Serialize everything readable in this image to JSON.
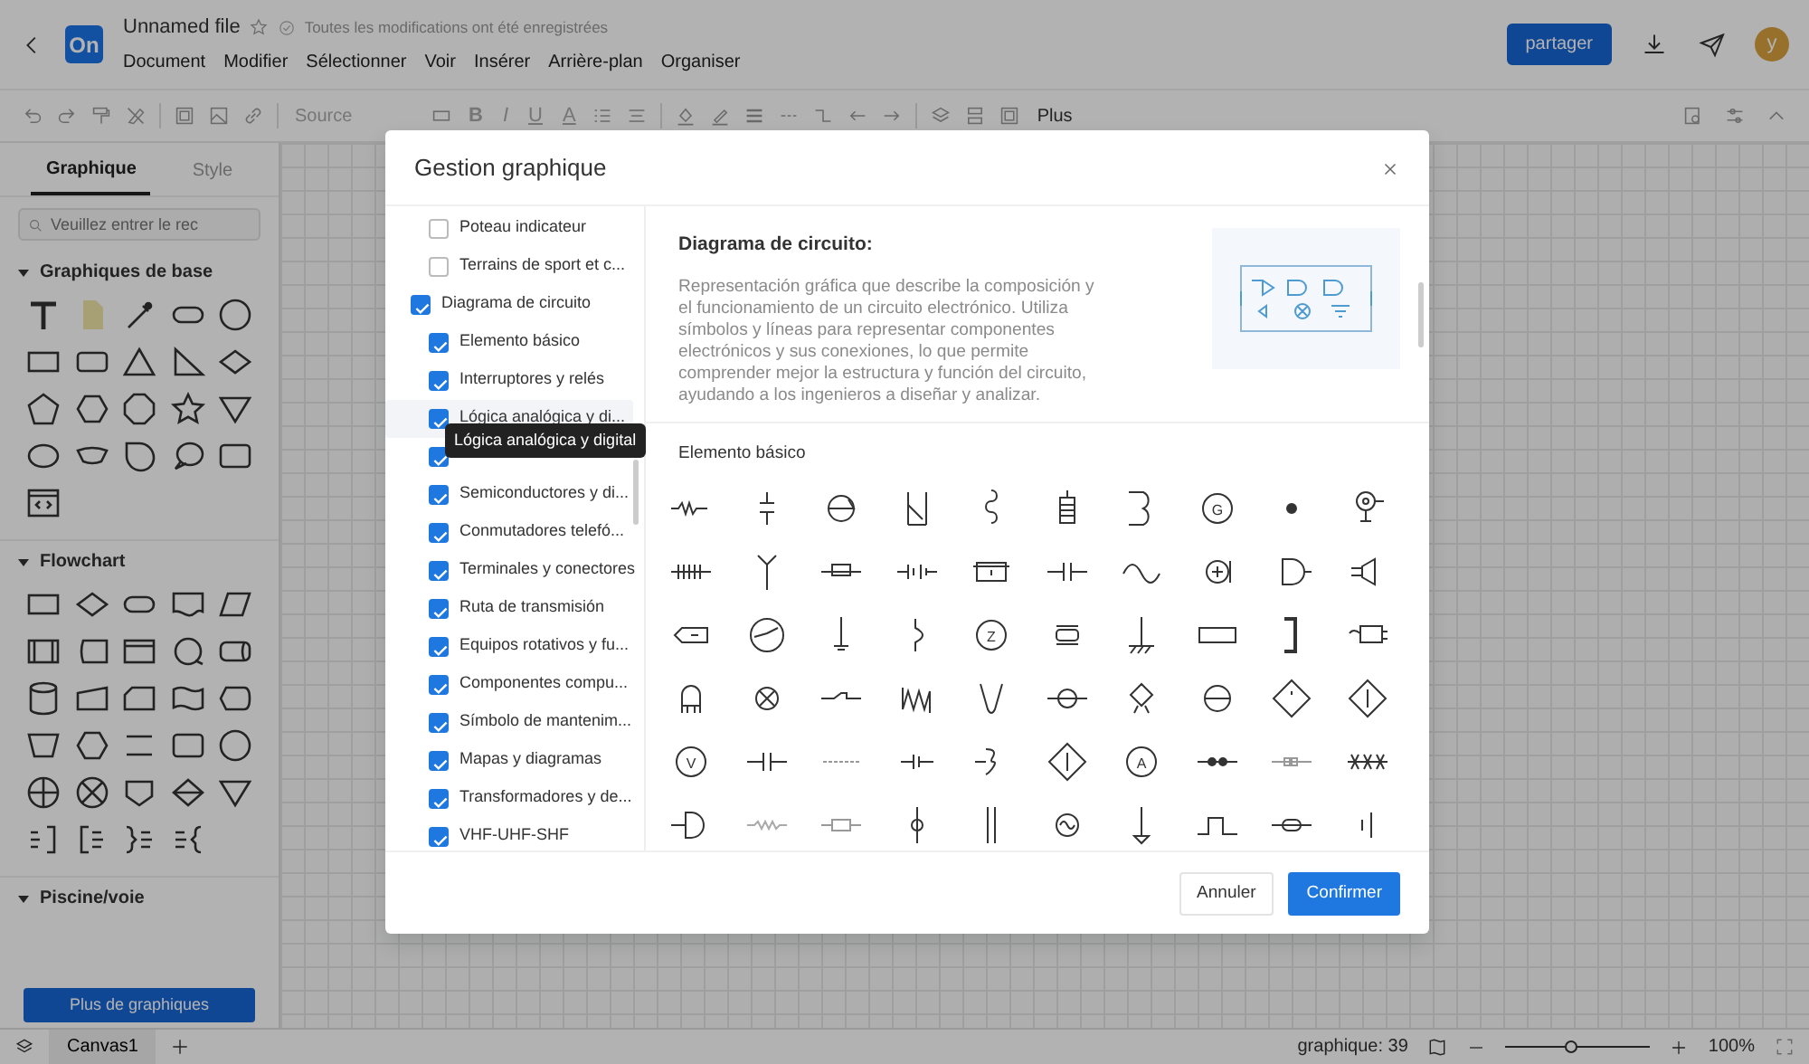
{
  "app": {
    "logo": "On",
    "file_name": "Unnamed file",
    "save_status": "Toutes les modifications ont été enregistrées",
    "menu": [
      "Document",
      "Modifier",
      "Sélectionner",
      "Voir",
      "Insérer",
      "Arrière-plan",
      "Organiser"
    ],
    "share_button": "partager",
    "avatar": "y"
  },
  "toolbar": {
    "font_field": "Source",
    "format_buttons": [
      "B",
      "I",
      "U",
      "A"
    ],
    "more": "Plus"
  },
  "sidebar": {
    "tabs": [
      {
        "label": "Graphique",
        "selected": true
      },
      {
        "label": "Style",
        "selected": false
      }
    ],
    "search": {
      "placeholder": "Veuillez entrer le rec"
    },
    "sections": [
      {
        "title": "Graphiques de base",
        "expanded": true
      },
      {
        "title": "Flowchart",
        "expanded": true
      },
      {
        "title": "Piscine/voie",
        "expanded": true
      }
    ],
    "more_button": "Plus de graphiques"
  },
  "dialog": {
    "title": "Gestion graphique",
    "tree": [
      {
        "children": [
          {
            "label": "Poteau indicateur",
            "checked": false,
            "hovered": false
          },
          {
            "label": "Terrains de sport et c...",
            "checked": false,
            "hovered": false
          }
        ]
      },
      {
        "label": "Diagrama de circuito",
        "checked": true,
        "children": [
          {
            "label": "Elemento básico",
            "checked": true,
            "hovered": false
          },
          {
            "label": "Interruptores y relés",
            "checked": true,
            "hovered": false
          },
          {
            "label": "Lógica analógica y di...",
            "checked": true,
            "hovered": true
          },
          {
            "checked": true,
            "hovered": false
          },
          {
            "label": "Semiconductores y di...",
            "checked": true,
            "hovered": false
          },
          {
            "label": "Conmutadores telefó...",
            "checked": true,
            "hovered": false
          },
          {
            "label": "Terminales y conectores",
            "checked": true,
            "hovered": false
          },
          {
            "label": "Ruta de transmisión",
            "checked": true,
            "hovered": false
          },
          {
            "label": "Equipos rotativos y fu...",
            "checked": true,
            "hovered": false
          },
          {
            "label": "Componentes compu...",
            "checked": true,
            "hovered": false
          },
          {
            "label": "Símbolo de mantenim...",
            "checked": true,
            "hovered": false
          },
          {
            "label": "Mapas y diagramas",
            "checked": true,
            "hovered": false
          },
          {
            "label": "Transformadores y de...",
            "checked": true,
            "hovered": false
          },
          {
            "label": "VHF-UHF-SHF",
            "checked": true,
            "hovered": false
          }
        ]
      }
    ],
    "tooltip": "Lógica analógica y digital",
    "detail": {
      "title": "Diagrama de circuito:",
      "description": "Representación gráfica que describe la composición y el funcionamiento de un circuito electrónico. Utiliza símbolos y líneas para representar componentes electrónicos y sus conexiones, lo que permite comprender mejor la estructura y función del circuito, ayudando a los ingenieros a diseñar y analizar.",
      "section": "Elemento básico",
      "symbol_labels": [
        "G",
        "Z",
        "V",
        "A"
      ]
    },
    "buttons": [
      {
        "label": "Annuler",
        "kind": "secondary"
      },
      {
        "label": "Confirmer",
        "kind": "primary"
      }
    ]
  },
  "bottom_bar": {
    "pages": [
      {
        "label": "Canvas1",
        "selected": true
      }
    ],
    "shape_count": "graphique: 39",
    "zoom": {
      "level": 0.45
    },
    "zoom_reading": "100%"
  }
}
